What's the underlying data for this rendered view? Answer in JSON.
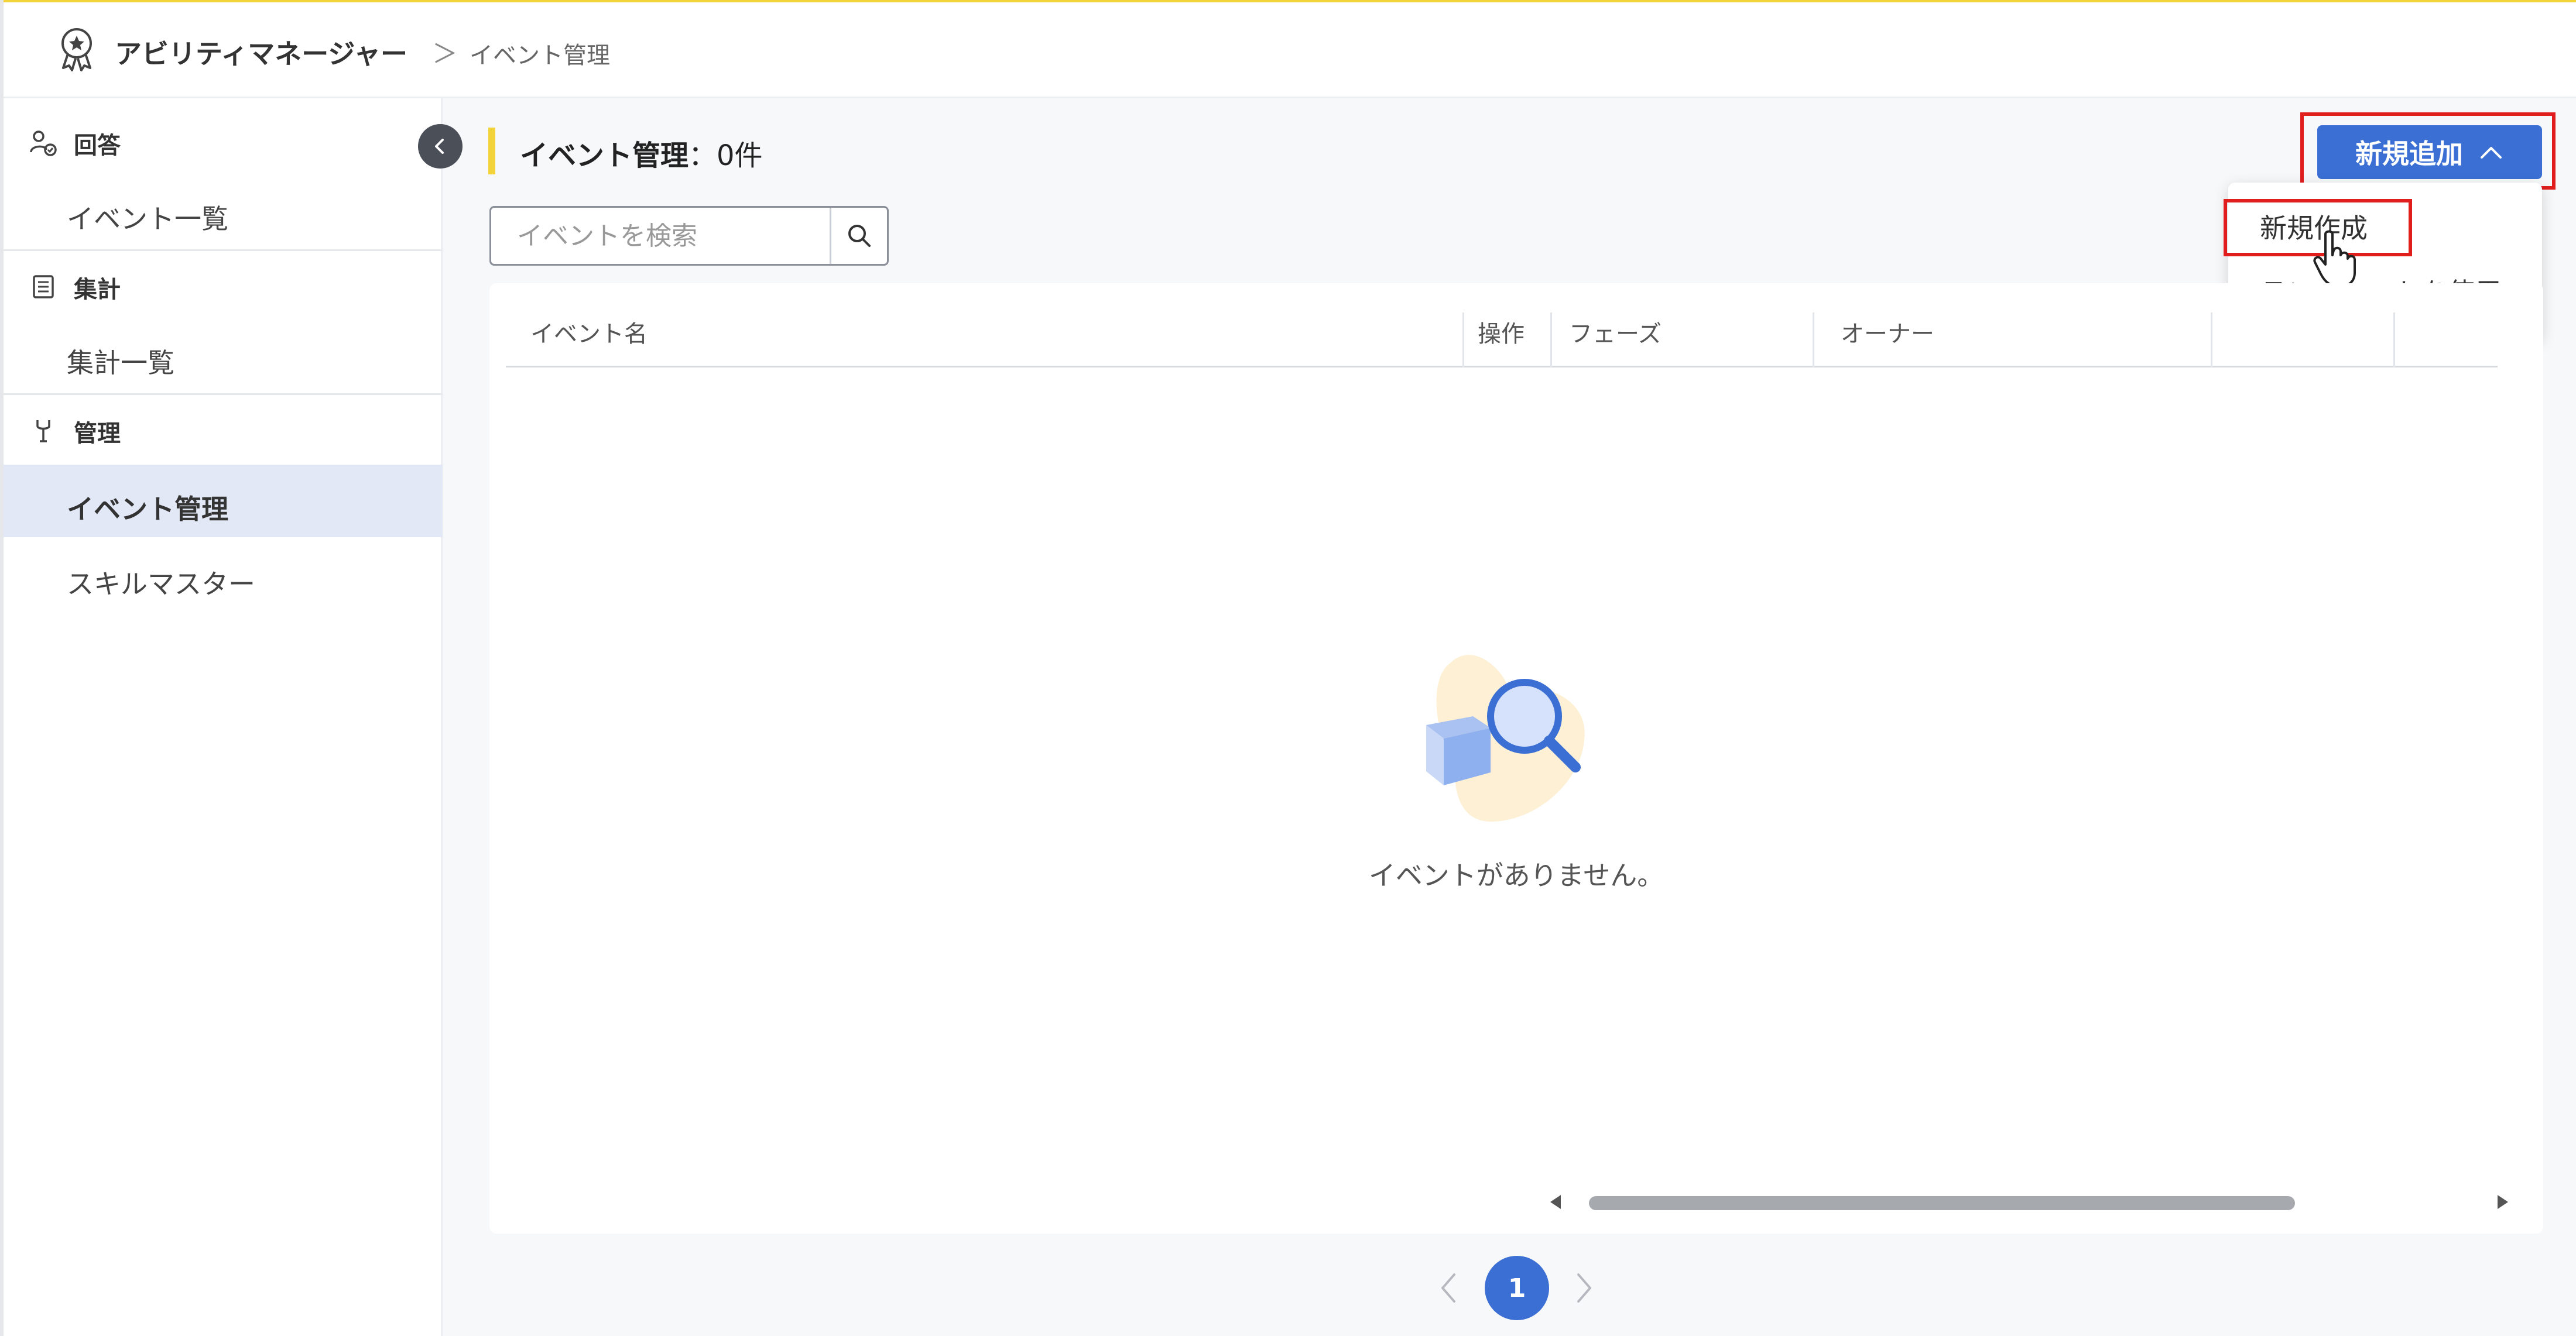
{
  "header": {
    "app_title": "アビリティマネージャー",
    "breadcrumb_separator": "＞",
    "breadcrumb_current": "イベント管理",
    "logo_icon": "award-ribbon-star-icon"
  },
  "sidebar": {
    "sections": [
      {
        "label": "回答",
        "icon": "user-check-icon",
        "items": [
          {
            "label": "イベント一覧",
            "active": false
          }
        ]
      },
      {
        "label": "集計",
        "icon": "list-document-icon",
        "items": [
          {
            "label": "集計一覧",
            "active": false
          }
        ]
      },
      {
        "label": "管理",
        "icon": "tools-icon",
        "items": [
          {
            "label": "イベント管理",
            "active": true
          },
          {
            "label": "スキルマスター",
            "active": false
          }
        ]
      }
    ],
    "collapse_icon": "chevron-left-icon"
  },
  "main": {
    "title": "イベント管理",
    "count_text": "：0件",
    "add_button_label": "新規追加",
    "add_button_icon": "chevron-up-icon",
    "dropdown_items": [
      "新規作成",
      "テンプレートを使用"
    ],
    "search": {
      "placeholder": "イベントを検索",
      "value": "",
      "icon": "search-icon"
    },
    "table": {
      "columns": [
        "イベント名",
        "操作",
        "フェーズ",
        "オーナー",
        "",
        ""
      ],
      "rows": []
    },
    "empty_message": "イベントがありません。",
    "pagination": {
      "current_page": "1"
    }
  },
  "colors": {
    "accent_yellow": "#f2d43a",
    "primary_blue": "#3b6fd4",
    "highlight_red": "#e01e1e",
    "active_nav_bg": "#e3e8f6"
  }
}
